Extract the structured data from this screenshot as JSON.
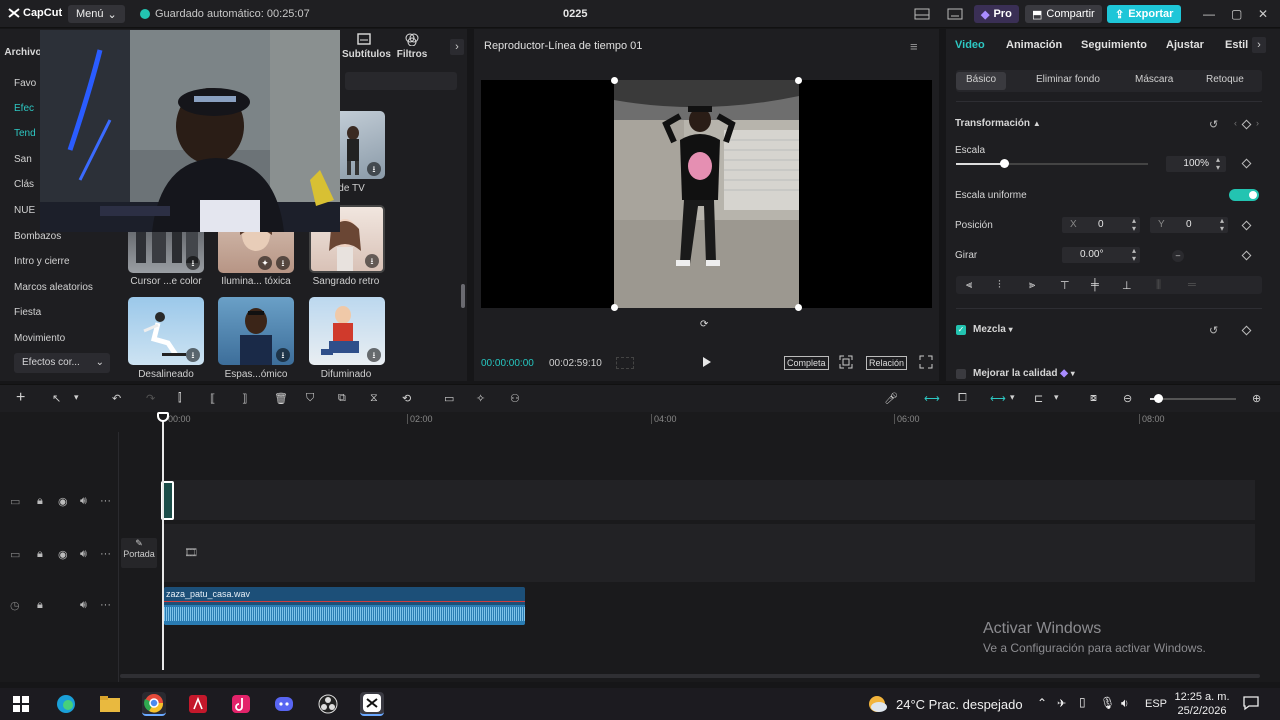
{
  "titlebar": {
    "logo_text": "CapCut",
    "menu_label": "Menú",
    "autosave": "Guardado automático: 00:25:07",
    "project_name": "0225",
    "pro_label": "Pro",
    "share_label": "Compartir",
    "export_label": "Exportar"
  },
  "left": {
    "tabs": [
      {
        "label": "Archivo"
      },
      {
        "label": "Subtítulos"
      },
      {
        "label": "Filtros"
      }
    ],
    "categories": [
      "Favo",
      "Efec",
      "Tend",
      "San",
      "Clás",
      "NUE",
      "Bombazos",
      "Intro y cierre",
      "Marcos aleatorios",
      "Fiesta",
      "Movimiento"
    ],
    "category_select": "Efectos cor...",
    "thumbs": [
      {
        "label": "... de TV"
      },
      {
        "label": "Cursor ...e color"
      },
      {
        "label": "Ilumina... tóxica"
      },
      {
        "label": "Sangrado retro"
      },
      {
        "label": "Desalineado"
      },
      {
        "label": "Espas...ómico"
      },
      {
        "label": "Difuminado"
      }
    ]
  },
  "player": {
    "title": "Reproductor-Línea de tiempo 01",
    "time_current": "00:00:00:00",
    "time_total": "00:02:59:10",
    "btn_full": "Completa",
    "btn_ratio": "Relación"
  },
  "right": {
    "tabs": [
      "Video",
      "Animación",
      "Seguimiento",
      "Ajustar",
      "Estil"
    ],
    "subtabs": [
      "Básico",
      "Eliminar fondo",
      "Máscara",
      "Retoque"
    ],
    "section_transform": "Transformación",
    "scale_label": "Escala",
    "scale_value": "100%",
    "scale_level": 0.25,
    "uniform_label": "Escala uniforme",
    "position_label": "Posición",
    "pos_x_label": "X",
    "pos_x": "0",
    "pos_y_label": "Y",
    "pos_y": "0",
    "rotate_label": "Girar",
    "rotate_value": "0.00°",
    "blend_label": "Mezcla",
    "enhance_label": "Mejorar la calidad"
  },
  "timeline": {
    "ruler": [
      "00:00",
      "02:00",
      "04:00",
      "06:00",
      "08:00"
    ],
    "cover_label": "Portada",
    "audio_clip_name": "zaza_patu_casa.wav"
  },
  "watermark": {
    "line1": "Activar Windows",
    "line2": "Ve a Configuración para activar Windows."
  },
  "taskbar": {
    "weather": "24°C  Prac. despejado",
    "lang": "ESP",
    "time": "12:25 a. m.",
    "date": "25/2/2026"
  },
  "colors": {
    "accent": "#2dc8c3",
    "export": "#1ec6d8",
    "audio_clip": "#1c4f78"
  }
}
